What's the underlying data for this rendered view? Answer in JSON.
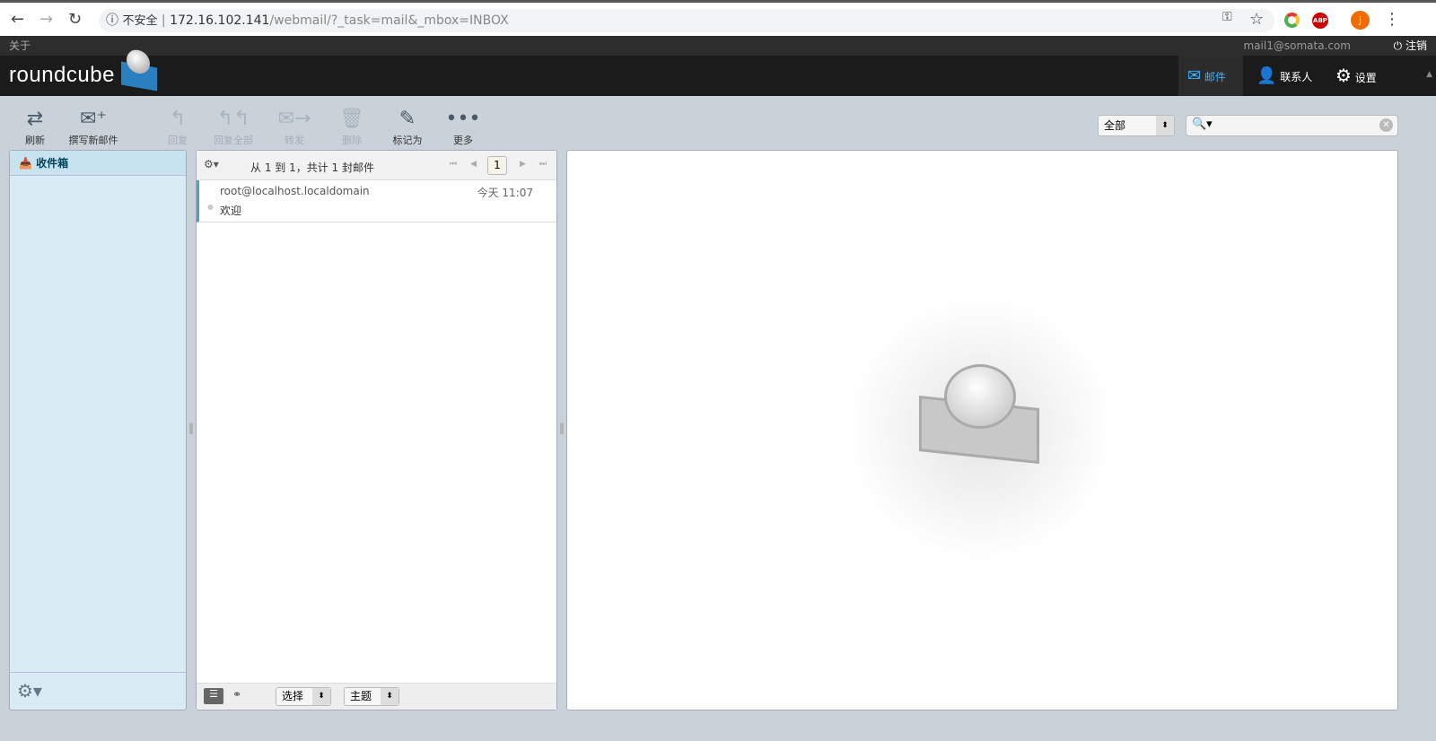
{
  "browser": {
    "insecure_label": "不安全",
    "url_host": "172.16.102.141",
    "url_path": "/webmail/?_task=mail&_mbox=INBOX",
    "profile_initial": "j"
  },
  "topbar": {
    "about": "关于",
    "user": "mail1@somata.com",
    "logout": "注销"
  },
  "header": {
    "logo": "roundcube",
    "tasks": [
      {
        "label": "邮件"
      },
      {
        "label": "联系人"
      },
      {
        "label": "设置"
      }
    ]
  },
  "toolbar": {
    "items": [
      {
        "label": "刷新"
      },
      {
        "label": "撰写新邮件"
      },
      {
        "label": "回复"
      },
      {
        "label": "回复全部"
      },
      {
        "label": "转发"
      },
      {
        "label": "删除"
      },
      {
        "label": "标记为"
      },
      {
        "label": "更多"
      }
    ],
    "filter": "全部",
    "search_placeholder": ""
  },
  "folders": [
    {
      "label": "收件箱"
    }
  ],
  "list": {
    "count_text": "从 1 到 1，共计 1 封邮件",
    "page": "1",
    "messages": [
      {
        "from": "root@localhost.localdomain",
        "date": "今天 11:07",
        "subject": "欢迎"
      }
    ],
    "select_label": "选择",
    "thread_label": "主题"
  }
}
